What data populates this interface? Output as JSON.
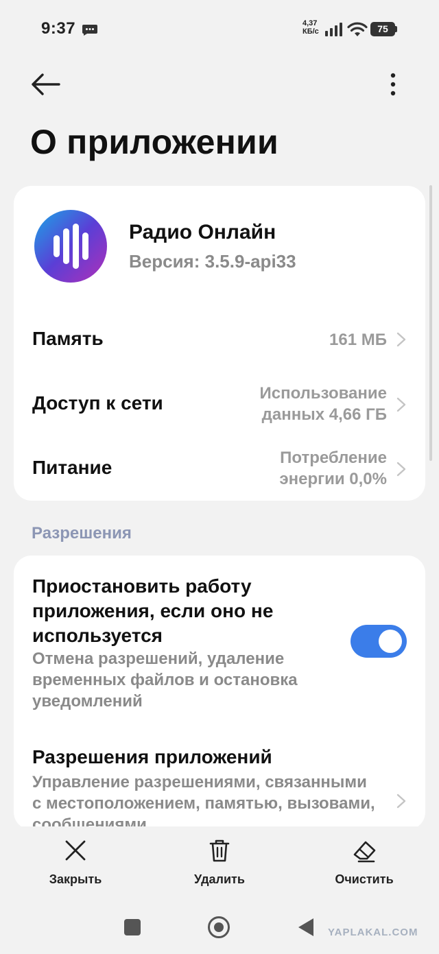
{
  "status_bar": {
    "time": "9:37",
    "speed_value": "4,37",
    "speed_unit": "КБ/с",
    "battery": "75"
  },
  "app_bar": {
    "title": "О приложении"
  },
  "app_info": {
    "name": "Радио Онлайн",
    "version": "Версия: 3.5.9-api33",
    "icon_colors": [
      "#1aa6e6",
      "#5a3fd6",
      "#b030b8"
    ]
  },
  "info_rows": [
    {
      "label": "Память",
      "value_line1": "161 МБ",
      "value_line2": ""
    },
    {
      "label": "Доступ к сети",
      "value_line1": "Использование",
      "value_line2": "данных 4,66 ГБ"
    },
    {
      "label": "Питание",
      "value_line1": "Потребление",
      "value_line2": "энергии 0,0%"
    }
  ],
  "permissions_section": {
    "header": "Разрешения",
    "pause_app": {
      "title": "Приостановить работу приложения, если оно не используется",
      "description": "Отмена разрешений, удаление временных файлов и остановка уведомлений",
      "enabled": true
    },
    "app_permissions": {
      "title": "Разрешения приложений",
      "description": "Управление разрешениями, связанными с местоположением, памятью, вызовами, сообщениями"
    }
  },
  "bottom_actions": [
    {
      "label": "Закрыть",
      "icon": "close-icon"
    },
    {
      "label": "Удалить",
      "icon": "trash-icon"
    },
    {
      "label": "Очистить",
      "icon": "eraser-icon"
    }
  ],
  "watermark": "YAPLAKAL.COM",
  "colors": {
    "accent": "#3b7de9",
    "section_header": "#8c96b4",
    "background": "#f2f2f2"
  }
}
